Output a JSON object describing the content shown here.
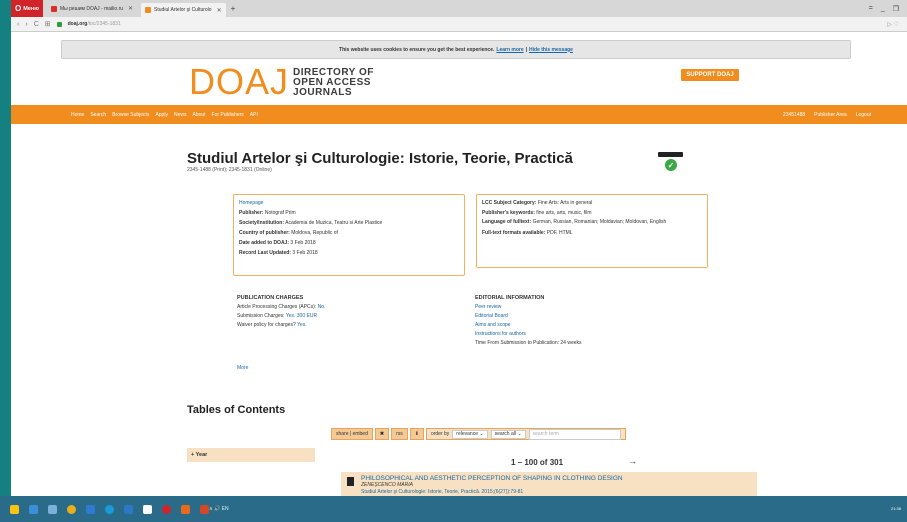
{
  "browser": {
    "opera_label": "Меню",
    "tabs": [
      {
        "title": "Мы решим DOAJ - mailio.ru",
        "favicon": "gmail-icon",
        "active": false
      },
      {
        "title": "Studiul Artelor şi Culturolo",
        "favicon": "doaj-icon",
        "active": true
      }
    ],
    "new_tab": "+",
    "url_host": "doaj.org",
    "url_path": "/toc/2345-1831",
    "window_controls": [
      "=",
      "_",
      "❐"
    ]
  },
  "cookie": {
    "text": "This website uses cookies to ensure you get the best experience.",
    "learn_more": "Learn more",
    "sep": "|",
    "hide": "Hide this message"
  },
  "header": {
    "logo": "DOAJ",
    "logo_sub": [
      "DIRECTORY OF",
      "OPEN ACCESS",
      "JOURNALS"
    ],
    "support_button": "SUPPORT DOAJ"
  },
  "nav": {
    "left": [
      "Home",
      "Search",
      "Browse Subjects",
      "Apply",
      "News",
      "About",
      "For Publishers",
      "API"
    ],
    "right": [
      "23451488",
      "Publisher Area",
      "Logout"
    ]
  },
  "journal": {
    "title": "Studiul Artelor şi Culturologie: Istorie, Teorie, Practică",
    "issn": "2345-1488 (Print); 2345-1831 (Online)"
  },
  "left_box": {
    "homepage": "Homepage",
    "publisher_label": "Publisher:",
    "publisher": "Notograf Prim",
    "society_label": "Society/Institution:",
    "society": "Academia de Muzica, Teatru si Arte Plastice",
    "country_label": "Country of publisher:",
    "country": "Moldova, Republic of",
    "date_added_label": "Date added to DOAJ:",
    "date_added": "3 Feb 2018",
    "record_label": "Record Last Updated:",
    "record": "3 Feb 2018"
  },
  "right_box": {
    "lcc_label": "LCC Subject Category:",
    "lcc": "Fine Arts: Arts in general",
    "keywords_label": "Publisher's keywords:",
    "keywords": "fine arts, arts, music, film",
    "language_label": "Language of fulltext:",
    "language": "German, Russian, Romanian; Moldavian; Moldovan, English",
    "formats_label": "Full-text formats available:",
    "formats": "PDF, HTML"
  },
  "publication_charges": {
    "heading": "PUBLICATION CHARGES",
    "apc_label": "Article Processing Charges (APCs):",
    "apc": "No.",
    "submission_label": "Submission Charges:",
    "submission": "Yes. 300 EUR",
    "waiver_label": "Waiver policy for charges?",
    "waiver": "Yes."
  },
  "editorial": {
    "heading": "EDITORIAL INFORMATION",
    "links": [
      "Peer review",
      "Editorial Board",
      "Aims and scope",
      "Instructions for authors"
    ],
    "time": "Time From Submission to Publication: 24 weeks"
  },
  "more": "More",
  "toc_heading": "Tables of Contents",
  "controls": {
    "share": "share | embed",
    "rss": "rss",
    "order_by": "order by",
    "relevance": "relevance",
    "search_all": "search all",
    "search_placeholder": "search term"
  },
  "year_facet": "+ Year",
  "pager": "1 – 100 of 301",
  "pager_next": "→",
  "result": {
    "title": "PHILOSOPHICAL AND AESTHETIC PERCEPTION OF SHAPING IN CLOTHING DESIGN",
    "author": "ZENEȘCENCO MARIA",
    "journal": "Studiul Artelor şi Culturologie: Istorie, Teorie, Practică. 2015;(6(27)):79-81"
  },
  "taskbar": {
    "tray": "∧ 🔊 EN",
    "time": "21:38"
  }
}
